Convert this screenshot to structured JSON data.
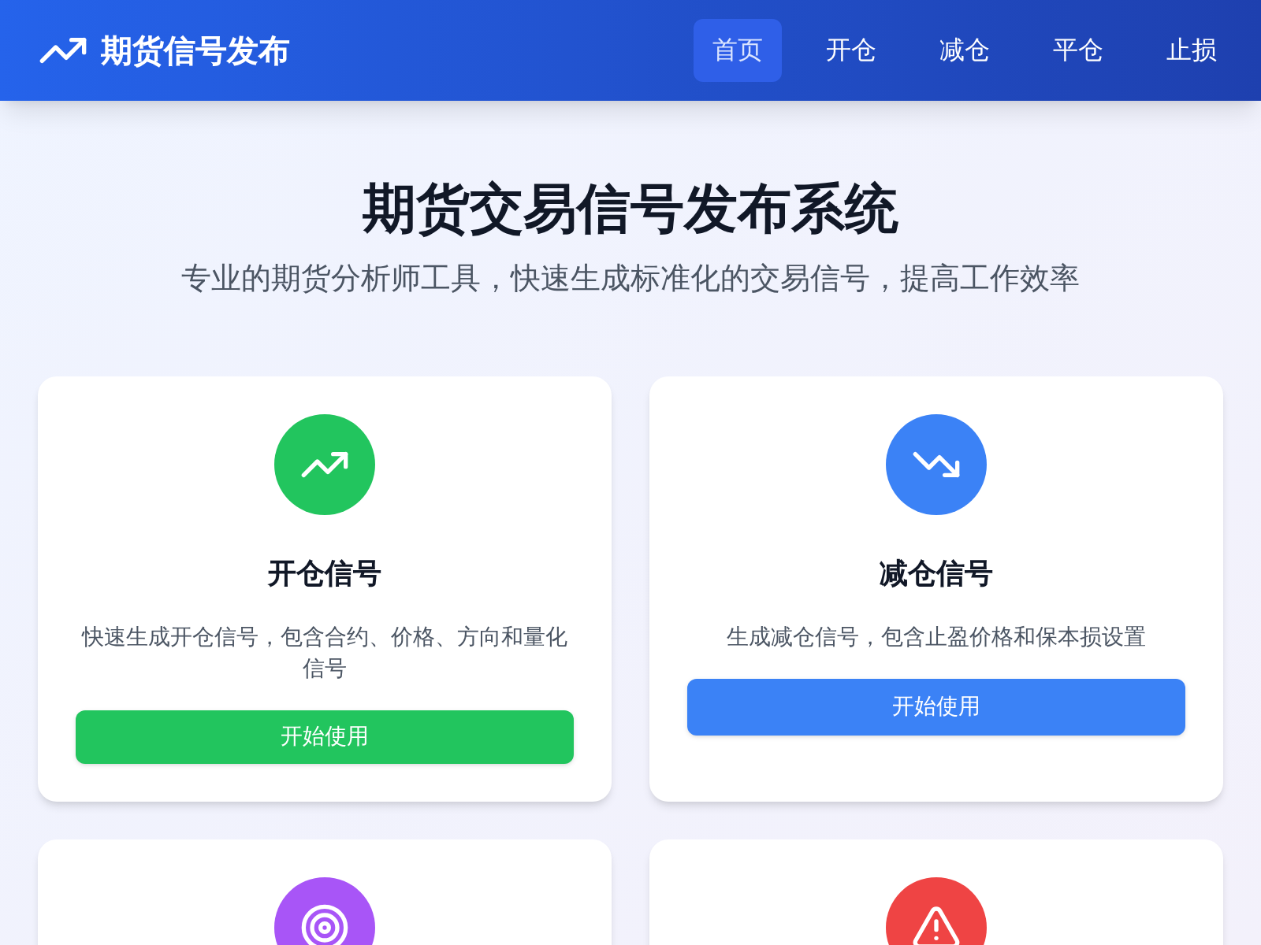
{
  "header": {
    "logo": "期货信号发布",
    "nav": [
      {
        "label": "首页",
        "selected": true
      },
      {
        "label": "开仓",
        "selected": false
      },
      {
        "label": "减仓",
        "selected": false
      },
      {
        "label": "平仓",
        "selected": false
      },
      {
        "label": "止损",
        "selected": false
      }
    ]
  },
  "hero": {
    "title": "期货交易信号发布系统",
    "subtitle": "专业的期货分析师工具，快速生成标准化的交易信号，提高工作效率"
  },
  "cards": [
    {
      "kind": "trending-up",
      "color": "#22c55e",
      "title": "开仓信号",
      "description": "快速生成开仓信号，包含合约、价格、方向和量化信号",
      "button": "开始使用"
    },
    {
      "kind": "trending-down",
      "color": "#3b82f6",
      "title": "减仓信号",
      "description": "生成减仓信号，包含止盈价格和保本损设置",
      "button": "开始使用"
    },
    {
      "kind": "target",
      "color": "#a855f7"
    },
    {
      "kind": "alert",
      "color": "#ef4444"
    }
  ]
}
